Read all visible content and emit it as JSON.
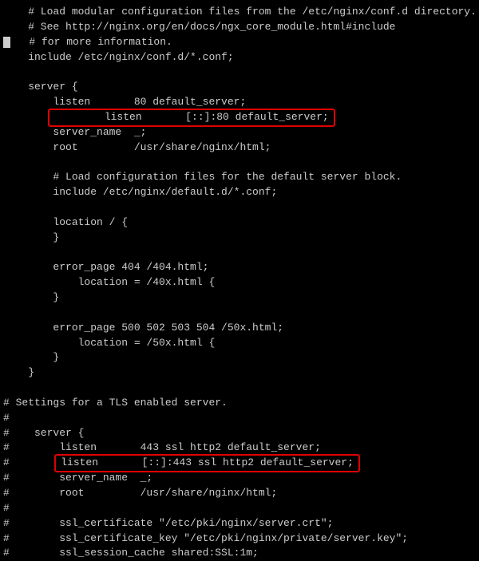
{
  "lines": {
    "l01": "    # Load modular configuration files from the /etc/nginx/conf.d directory.",
    "l02": "    # See http://nginx.org/en/docs/ngx_core_module.html#include",
    "l03": "# for more information.",
    "l04": "    include /etc/nginx/conf.d/*.conf;",
    "l05": "",
    "l06": "    server {",
    "l07": "        listen       80 default_server;",
    "l08": "        listen       [::]:80 default_server;",
    "l09": "        server_name  _;",
    "l10": "        root         /usr/share/nginx/html;",
    "l11": "",
    "l12": "        # Load configuration files for the default server block.",
    "l13": "        include /etc/nginx/default.d/*.conf;",
    "l14": "",
    "l15": "        location / {",
    "l16": "        }",
    "l17": "",
    "l18": "        error_page 404 /404.html;",
    "l19": "            location = /40x.html {",
    "l20": "        }",
    "l21": "",
    "l22": "        error_page 500 502 503 504 /50x.html;",
    "l23": "            location = /50x.html {",
    "l24": "        }",
    "l25": "    }",
    "l26": "",
    "l27": "# Settings for a TLS enabled server.",
    "l28": "#",
    "l29": "#    server {",
    "l30": "#        listen       443 ssl http2 default_server;",
    "l31a": "#        ",
    "l31b": "listen       [::]:443 ssl http2 default_server;",
    "l32": "#        server_name  _;",
    "l33": "#        root         /usr/share/nginx/html;",
    "l34": "#",
    "l35": "#        ssl_certificate \"/etc/pki/nginx/server.crt\";",
    "l36": "#        ssl_certificate_key \"/etc/pki/nginx/private/server.key\";",
    "l37": "#        ssl_session_cache shared:SSL:1m;"
  }
}
